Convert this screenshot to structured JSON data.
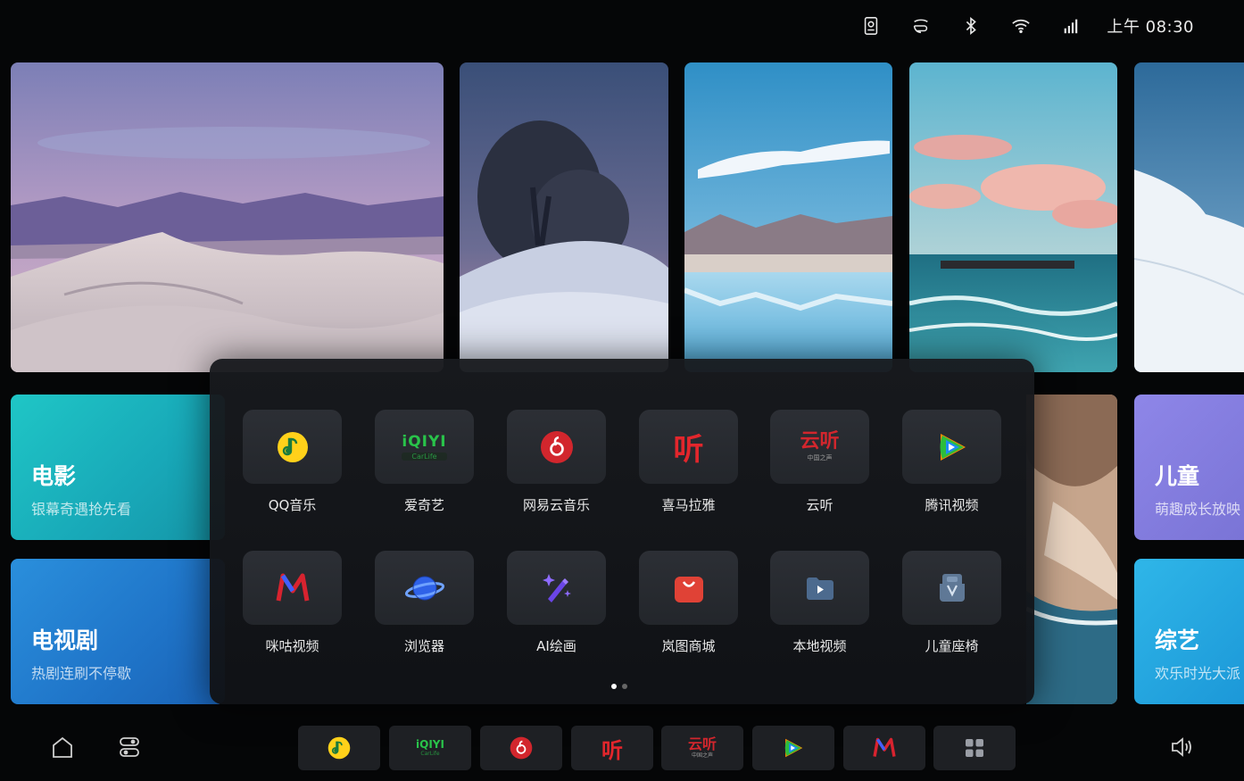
{
  "status_bar": {
    "time": "上午 08:30",
    "icons": [
      "driver-icon",
      "steering-icon",
      "bluetooth-icon",
      "wifi-icon",
      "signal-icon"
    ]
  },
  "tiles": {
    "movie": {
      "title": "电影",
      "subtitle": "银幕奇遇抢先看"
    },
    "tv": {
      "title": "电视剧",
      "subtitle": "热剧连刷不停歇"
    },
    "kids": {
      "title": "儿童",
      "subtitle": "萌趣成长放映"
    },
    "variety": {
      "title": "综艺",
      "subtitle": "欢乐时光大派"
    }
  },
  "apps": [
    {
      "name": "QQ音乐",
      "icon": "qq-music-icon"
    },
    {
      "name": "爱奇艺",
      "icon": "iqiyi-icon",
      "logo": "iQIYI",
      "logo_sub": "CarLife"
    },
    {
      "name": "网易云音乐",
      "icon": "netease-music-icon"
    },
    {
      "name": "喜马拉雅",
      "icon": "ximalaya-icon",
      "logo": "听"
    },
    {
      "name": "云听",
      "icon": "yunting-icon",
      "logo": "云听",
      "logo_sub": "中国之声"
    },
    {
      "name": "腾讯视频",
      "icon": "tencent-video-icon"
    },
    {
      "name": "咪咕视频",
      "icon": "migu-video-icon"
    },
    {
      "name": "浏览器",
      "icon": "browser-icon"
    },
    {
      "name": "AI绘画",
      "icon": "ai-paint-icon"
    },
    {
      "name": "岚图商城",
      "icon": "voyah-mall-icon"
    },
    {
      "name": "本地视频",
      "icon": "local-video-icon"
    },
    {
      "name": "儿童座椅",
      "icon": "child-seat-icon"
    }
  ],
  "page_indicator": {
    "total": 2,
    "current": 1
  },
  "dock": {
    "left": [
      "home-icon",
      "settings-icon"
    ],
    "apps": [
      "qq-music-icon",
      "iqiyi-icon",
      "netease-music-icon",
      "ximalaya-icon",
      "yunting-icon",
      "tencent-video-icon",
      "migu-video-icon",
      "all-apps-icon"
    ],
    "right": [
      "volume-icon"
    ]
  },
  "colors": {
    "accent_red": "#d2262d",
    "movie_tile": "#1fc6c6",
    "tv_tile": "#2a8fdc",
    "kids_tile": "#8e86e8",
    "variety_tile": "#2fb6e8"
  }
}
